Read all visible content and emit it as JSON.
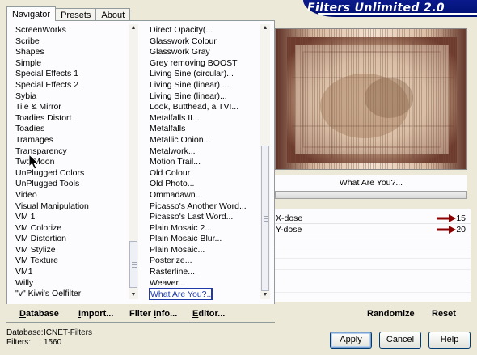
{
  "tabs": [
    "Navigator",
    "Presets",
    "About"
  ],
  "app_title": "Filters Unlimited 2.0",
  "categories": [
    "ScreenWorks",
    "Scribe",
    "Shapes",
    "Simple",
    "Special Effects 1",
    "Special Effects 2",
    "Sybia",
    "Tile & Mirror",
    "Toadies Distort",
    "Toadies",
    "Tramages",
    "Transparency",
    "Two Moon",
    "UnPlugged Colors",
    "UnPlugged Tools",
    "Video",
    "Visual Manipulation",
    "VM 1",
    "VM Colorize",
    "VM Distortion",
    "VM Stylize",
    "VM Texture",
    "VM1",
    "Willy",
    "\"v\" Kiwi's Oelfilter"
  ],
  "filters": [
    "Direct Opacity(...",
    "Glasswork Colour",
    "Glasswork Gray",
    "Grey removing BOOST",
    "Living Sine (circular)...",
    "Living Sine (linear) ...",
    "Living Sine (linear)...",
    "Look, Butthead, a TV!...",
    "Metalfalls II...",
    "Metalfalls",
    "Metallic Onion...",
    "Metalwork...",
    "Motion Trail...",
    "Old Colour",
    "Old Photo...",
    "Ommadawn...",
    "Picasso's Another Word...",
    "Picasso's Last Word...",
    "Plain Mosaic 2...",
    "Plain Mosaic Blur...",
    "Plain Mosaic...",
    "Posterize...",
    "Rasterline...",
    "Weaver...",
    "What Are You?..."
  ],
  "selected_filter_index": 24,
  "left_buttons": {
    "database": {
      "label": "atabase",
      "accel": "D"
    },
    "import": {
      "label": "mport...",
      "accel": "I"
    },
    "filter_info": {
      "label": "Filter ",
      "accel": "I",
      "rest": "nfo..."
    },
    "editor": {
      "label": "E",
      "accel": "E",
      "rest": "ditor..."
    }
  },
  "filter_name": "What Are You?...",
  "params": [
    {
      "label": "X-dose",
      "value": "15"
    },
    {
      "label": "Y-dose",
      "value": "20"
    }
  ],
  "randomize_label": "Randomize",
  "reset_label": "Reset",
  "status": {
    "database_label": "Database:",
    "database_value": "ICNET-Filters",
    "filters_label": "Filters:",
    "filters_value": "1560"
  },
  "buttons": {
    "apply": "Apply",
    "cancel": "Cancel",
    "help": "Help"
  },
  "colors": {
    "banner": "#0a1a8c",
    "arrow": "#8b0000",
    "selection_border": "#1f3aa6"
  }
}
